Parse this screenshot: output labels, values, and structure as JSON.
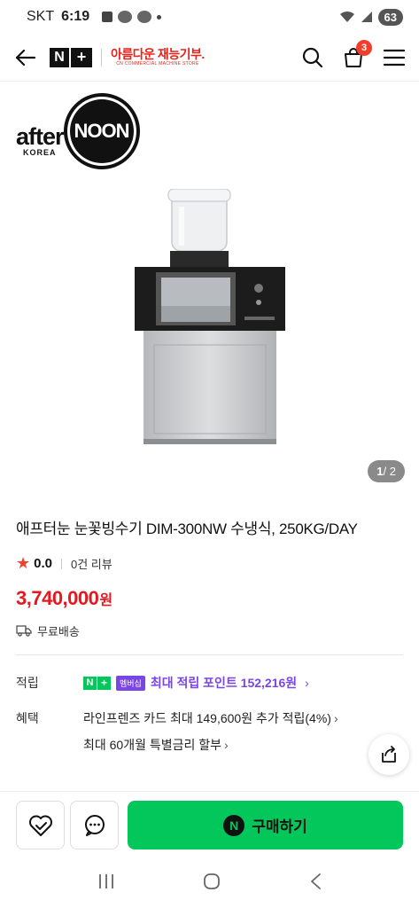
{
  "status_bar": {
    "carrier": "SKT",
    "time": "6:19",
    "battery": "63"
  },
  "header": {
    "logo_n": "N",
    "logo_plus": "+",
    "brand_title": "아름다운 재능기부.",
    "brand_subtitle": "CN COMMERCIAL MACHINE STORE",
    "cart_count": "3"
  },
  "gallery": {
    "brand_after": "after",
    "brand_noon": "NOON",
    "brand_korea": "KOREA",
    "pager_current": "1",
    "pager_total": "/ 2"
  },
  "product": {
    "title": "애프터눈 눈꽃빙수기 DIM-300NW 수냉식, 250KG/DAY",
    "rating": "0.0",
    "reviews": "0건 리뷰",
    "price": "3,740,000",
    "price_unit": "원",
    "shipping": "무료배송"
  },
  "benefits": {
    "points_label": "적립",
    "member_tag": "멤버십",
    "points_text": "최대 적립 포인트 152,216원",
    "benefit_label": "혜택",
    "benefit_line1": "라인프렌즈 카드 최대 149,600원 추가 적립(4%)",
    "benefit_line2": "최대 60개월 특별금리 할부"
  },
  "bottom_bar": {
    "buy_label": "구매하기",
    "buy_icon": "N"
  },
  "colors": {
    "naver_green": "#03c75a",
    "price_red": "#e5171f",
    "membership_purple": "#7a45e6"
  }
}
